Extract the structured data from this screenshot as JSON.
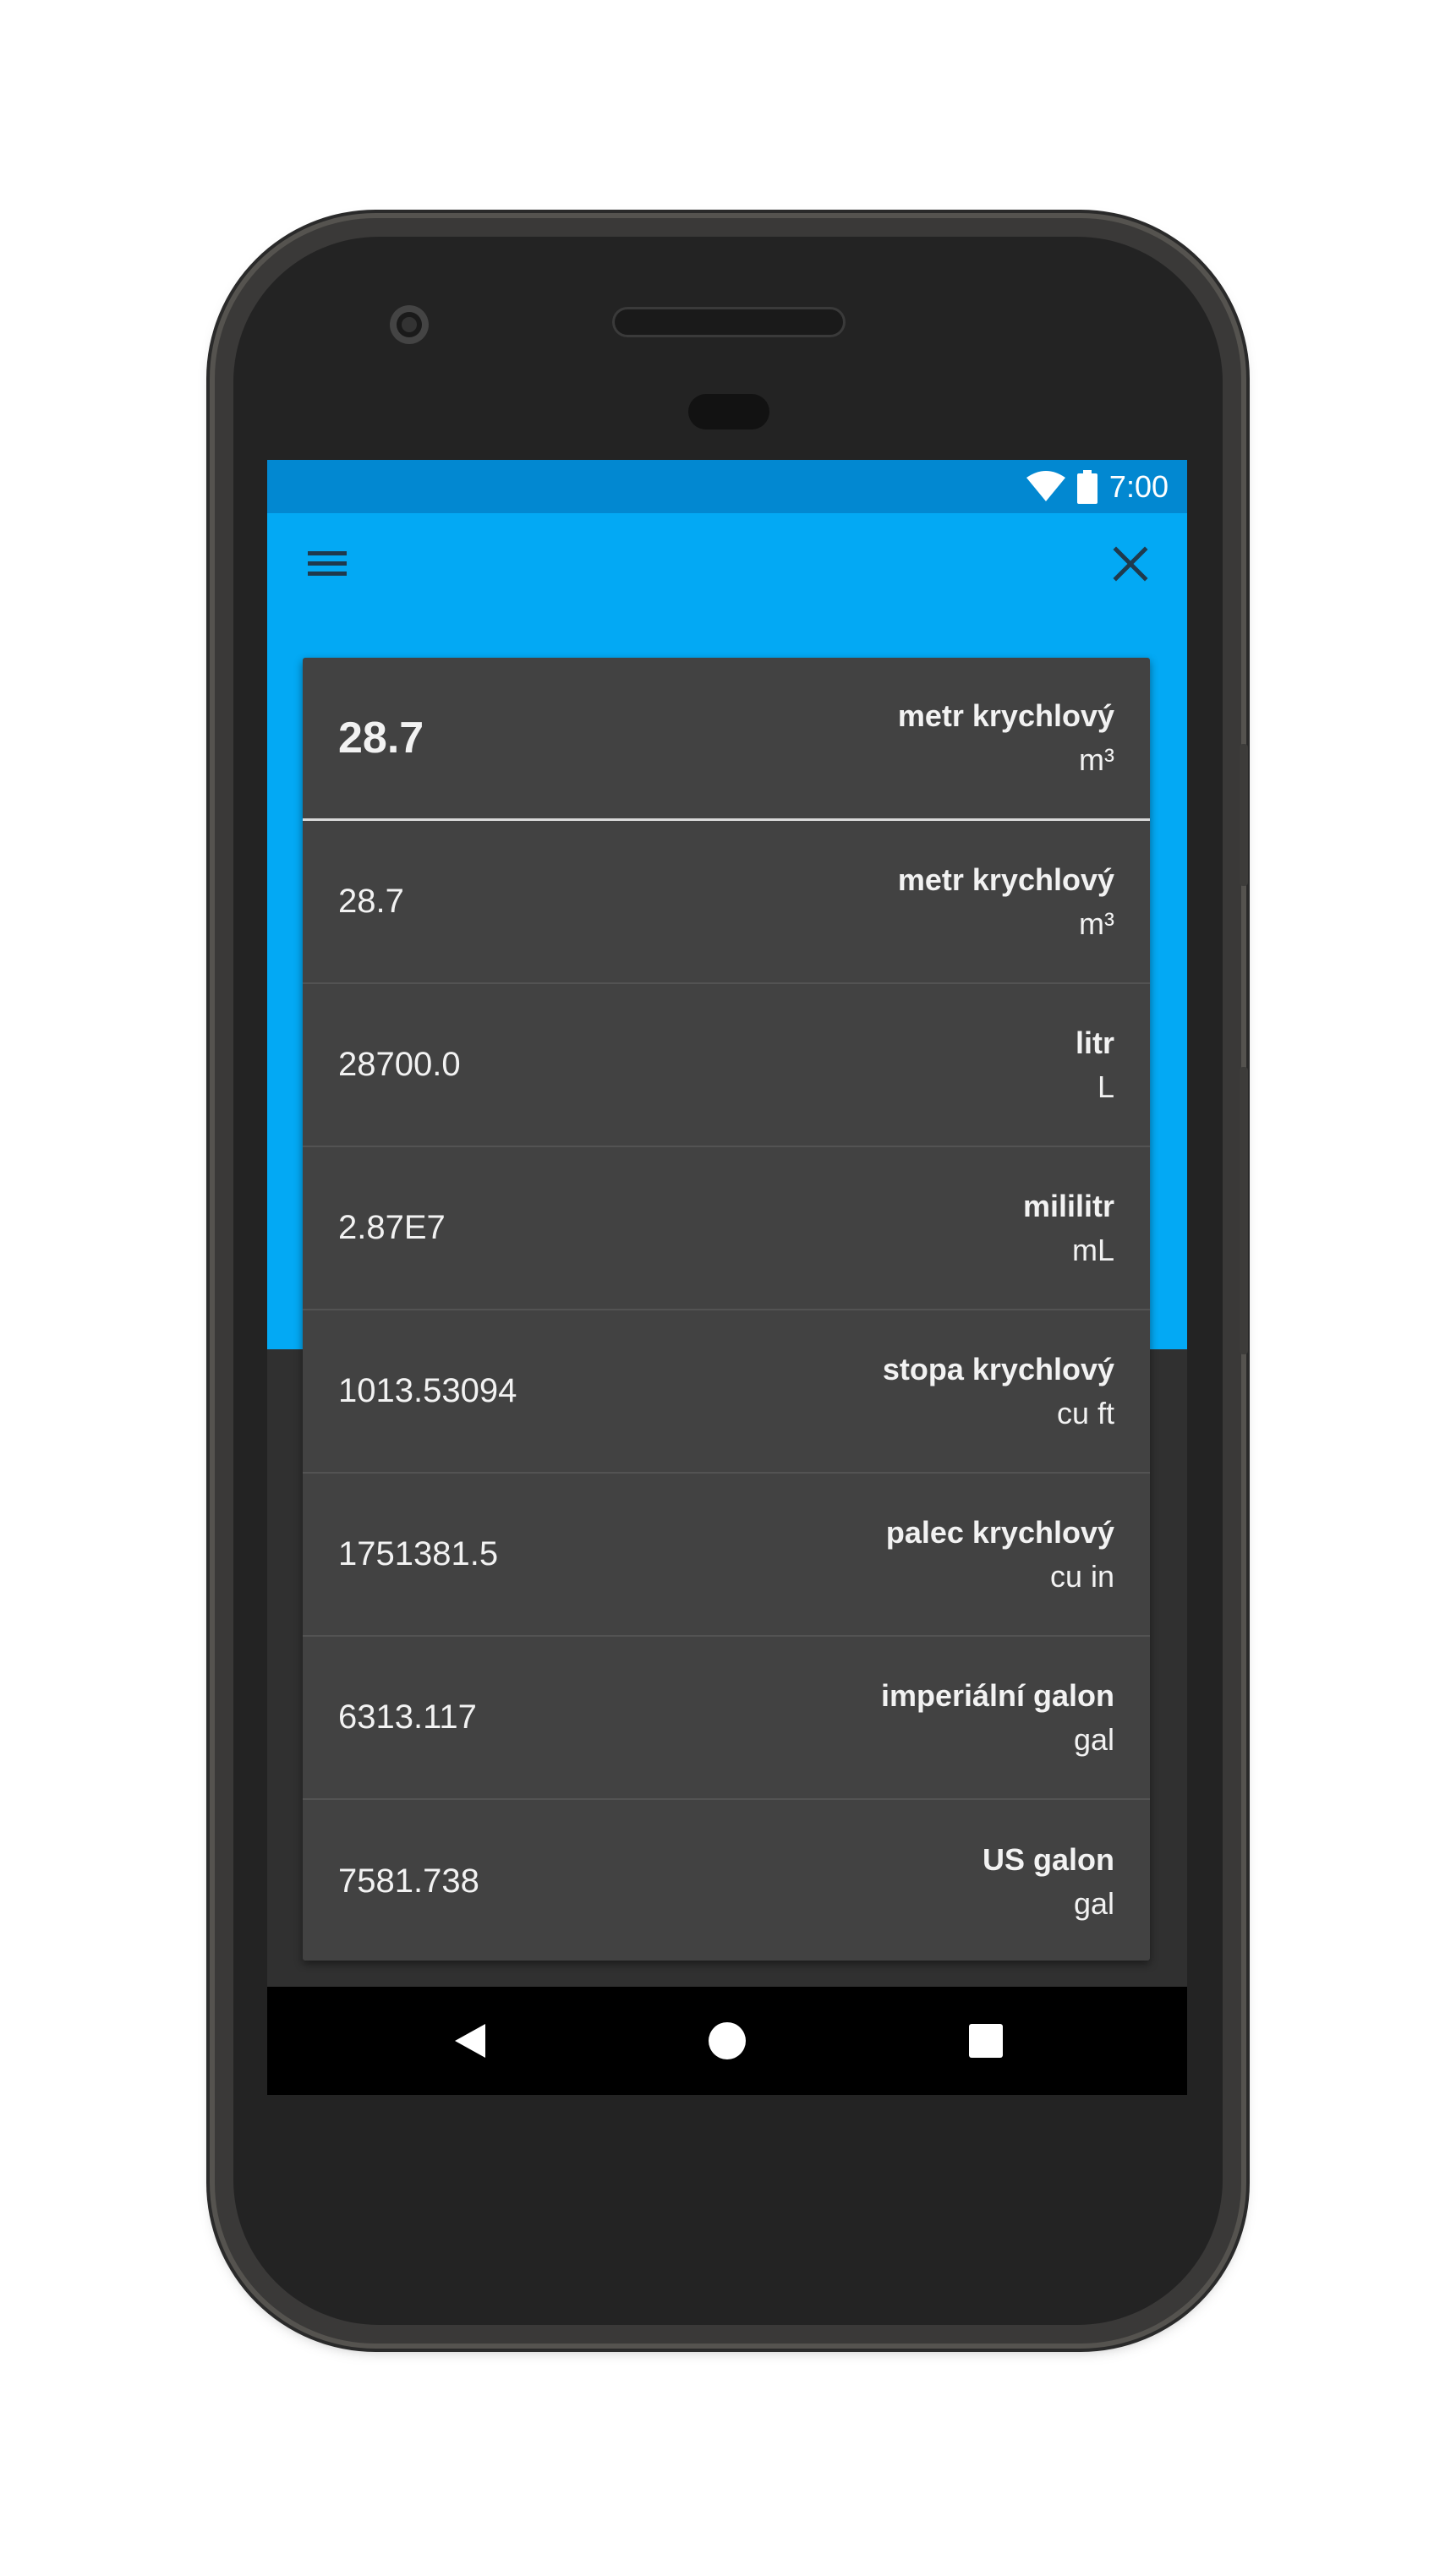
{
  "status_bar": {
    "time": "7:00",
    "icons": [
      "wifi-icon",
      "battery-icon"
    ]
  },
  "toolbar": {
    "menu_icon": "hamburger-menu-icon",
    "close_icon": "close-icon"
  },
  "input": {
    "value": "28.7",
    "unit_name": "metr krychlový",
    "unit_abbr": "m³"
  },
  "results": [
    {
      "value": "28.7",
      "unit_name": "metr krychlový",
      "unit_abbr": "m³"
    },
    {
      "value": "28700.0",
      "unit_name": "litr",
      "unit_abbr": "L"
    },
    {
      "value": "2.87E7",
      "unit_name": "mililitr",
      "unit_abbr": "mL"
    },
    {
      "value": "1013.53094",
      "unit_name": "stopa krychlový",
      "unit_abbr": "cu ft"
    },
    {
      "value": "1751381.5",
      "unit_name": "palec krychlový",
      "unit_abbr": "cu in"
    },
    {
      "value": "6313.117",
      "unit_name": "imperiální galon",
      "unit_abbr": "gal"
    },
    {
      "value": "7581.738",
      "unit_name": "US galon",
      "unit_abbr": "gal"
    }
  ],
  "nav_bar": {
    "icons": [
      "back-icon",
      "home-icon",
      "recents-icon"
    ]
  },
  "colors": {
    "status_bar": "#0288d1",
    "app_bar": "#03a9f4",
    "background": "#303030",
    "card": "#424242"
  }
}
